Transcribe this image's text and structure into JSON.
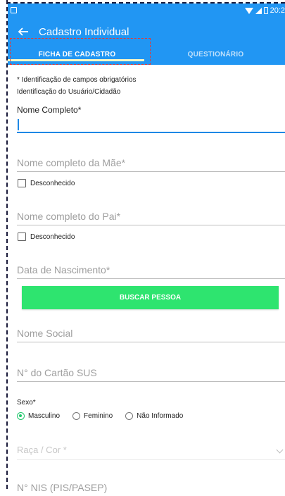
{
  "app": {
    "title": "Cadastro Individual",
    "status_time": "20:2"
  },
  "tabs": [
    {
      "label": "FICHA DE CADASTRO",
      "active": true
    },
    {
      "label": "QUESTIONÁRIO",
      "active": false
    }
  ],
  "form": {
    "required_hint": "* Identificação de campos obrigatórios",
    "section_title": "Identificação do Usuário/Cidadão",
    "nome_completo": {
      "label": "Nome Completo*",
      "value": ""
    },
    "nome_mae": {
      "placeholder": "Nome completo da Mãe*",
      "unknown_label": "Desconhecido"
    },
    "nome_pai": {
      "placeholder": "Nome completo do Pai*",
      "unknown_label": "Desconhecido"
    },
    "data_nascimento": {
      "placeholder": "Data de Nascimento*"
    },
    "buscar_pessoa_label": "BUSCAR PESSOA",
    "nome_social": {
      "placeholder": "Nome Social"
    },
    "cartao_sus": {
      "placeholder": "N° do Cartão SUS"
    },
    "sexo": {
      "label": "Sexo*",
      "options": [
        "Masculino",
        "Feminino",
        "Não Informado"
      ],
      "selected": "Masculino"
    },
    "raca_cor": {
      "placeholder": "Raça / Cor *"
    },
    "nis": {
      "placeholder": "N° NIS (PIS/PASEP)"
    }
  },
  "colors": {
    "appbar": "#2196f3",
    "accent": "#1e88e5",
    "button": "#2ee46f",
    "radio_checked": "#1ec86b"
  }
}
